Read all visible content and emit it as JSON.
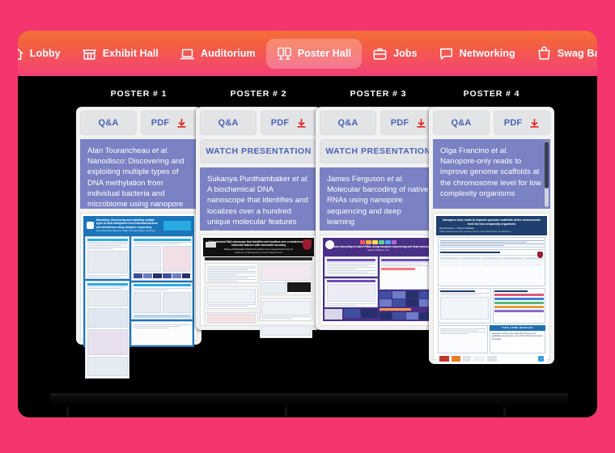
{
  "page": {
    "background_color": "#f5356e",
    "stage_color": "#000000"
  },
  "nav": {
    "gradient_from": "#f4703a",
    "gradient_to": "#f23f77",
    "active_item": "Poster Hall",
    "items": [
      {
        "label": "Lobby",
        "icon": "home-icon",
        "active": false
      },
      {
        "label": "Exhibit Hall",
        "icon": "storefront-icon",
        "active": false
      },
      {
        "label": "Auditorium",
        "icon": "laptop-icon",
        "active": false
      },
      {
        "label": "Poster Hall",
        "icon": "posters-icon",
        "active": true
      },
      {
        "label": "Jobs",
        "icon": "briefcase-icon",
        "active": false
      },
      {
        "label": "Networking",
        "icon": "chat-bubble-icon",
        "active": false
      },
      {
        "label": "Swag Bag",
        "icon": "shopping-bag-icon",
        "active": false
      }
    ]
  },
  "buttons": {
    "qa_label": "Q&A",
    "pdf_label": "PDF",
    "download_icon": "download-icon",
    "watch_label": "WATCH PRESENTATION",
    "label_color": "#4a63b5",
    "download_icon_color": "#e02020",
    "background_color": "#e3e4e6"
  },
  "posters": [
    {
      "number_label": "POSTER # 1",
      "authors": "Alan Tourancheau",
      "et_al": "et al.",
      "title": "Nanodisco: Discovering and exploiting multiple types of DNA methylation from individual bacteria and microbiome using nanopore sequencing",
      "has_watch_presentation": false,
      "has_scrollbar": false,
      "title_bg": "#7a82c4",
      "thumbnail": {
        "header_color": "#1b75bb",
        "accent_color": "#29abe2",
        "theme": "blue",
        "header_title": "Nanodisco: Discovering and exploiting multiple types of DNA methylation from individual bacteria and microbiome using nanopore sequencing",
        "header_authors": "Alan Tourancheau | Edward A. Mead | Xue-Song Zhang | Gang Fang"
      }
    },
    {
      "number_label": "POSTER # 2",
      "authors": "Sukanya Punthambaker",
      "et_al": "et al.",
      "title": "A biochemical DNA nanoscope that identifies and localizes over a hundred unique molecular features with nanometer",
      "has_watch_presentation": true,
      "has_scrollbar": false,
      "title_bg": "#7a82c4",
      "thumbnail": {
        "header_color": "#111111",
        "accent_color": "#9d1b2e",
        "theme": "black",
        "header_title": "A biochemical DNA nanoscope that identifies and localizes over a hundred unique molecular features with nanometer accuracy",
        "header_authors": "Sukanya Punthambaker, Richard Terry, Daniel Levner, George Church, Peng Yin"
      }
    },
    {
      "number_label": "POSTER # 3",
      "authors": "James Ferguson",
      "et_al": "et al.",
      "title": "Molecular barcoding of native RNAs using nanopore sequencing and deep learning",
      "has_watch_presentation": true,
      "has_scrollbar": false,
      "title_bg": "#7a82c4",
      "thumbnail": {
        "header_color": "#4a2f87",
        "accent_color": "#6b4bb5",
        "theme": "purple",
        "header_title": "Molecular barcoding of native RNAs using nanopore sequencing and deep learning",
        "header_authors": "James M. Ferguson, et al."
      }
    },
    {
      "number_label": "POSTER # 4",
      "authors": "Olga Francino",
      "et_al": "et al.",
      "title": "Nanopore-only reads to improve genome scaffolds at the chromosome level for low complexity organisms",
      "has_watch_presentation": false,
      "has_scrollbar": true,
      "title_bg": "#7a82c4",
      "thumbnail": {
        "header_color": "#1f3f6e",
        "accent_color": "#2b5a9e",
        "theme": "navy",
        "header_title": "Nanopore-only reads to improve genome scaffolds at the chromosome level for low complexity organisms",
        "header_authors": "Sara D'Andreano, J. Viñas, O. Francino",
        "callout_label": "TAKE-HOME MESSAGE",
        "callout_text": "Nanopore-only de novo assembly improves the scaffolding of genomes, even at the chromosome level for quality"
      }
    }
  ]
}
